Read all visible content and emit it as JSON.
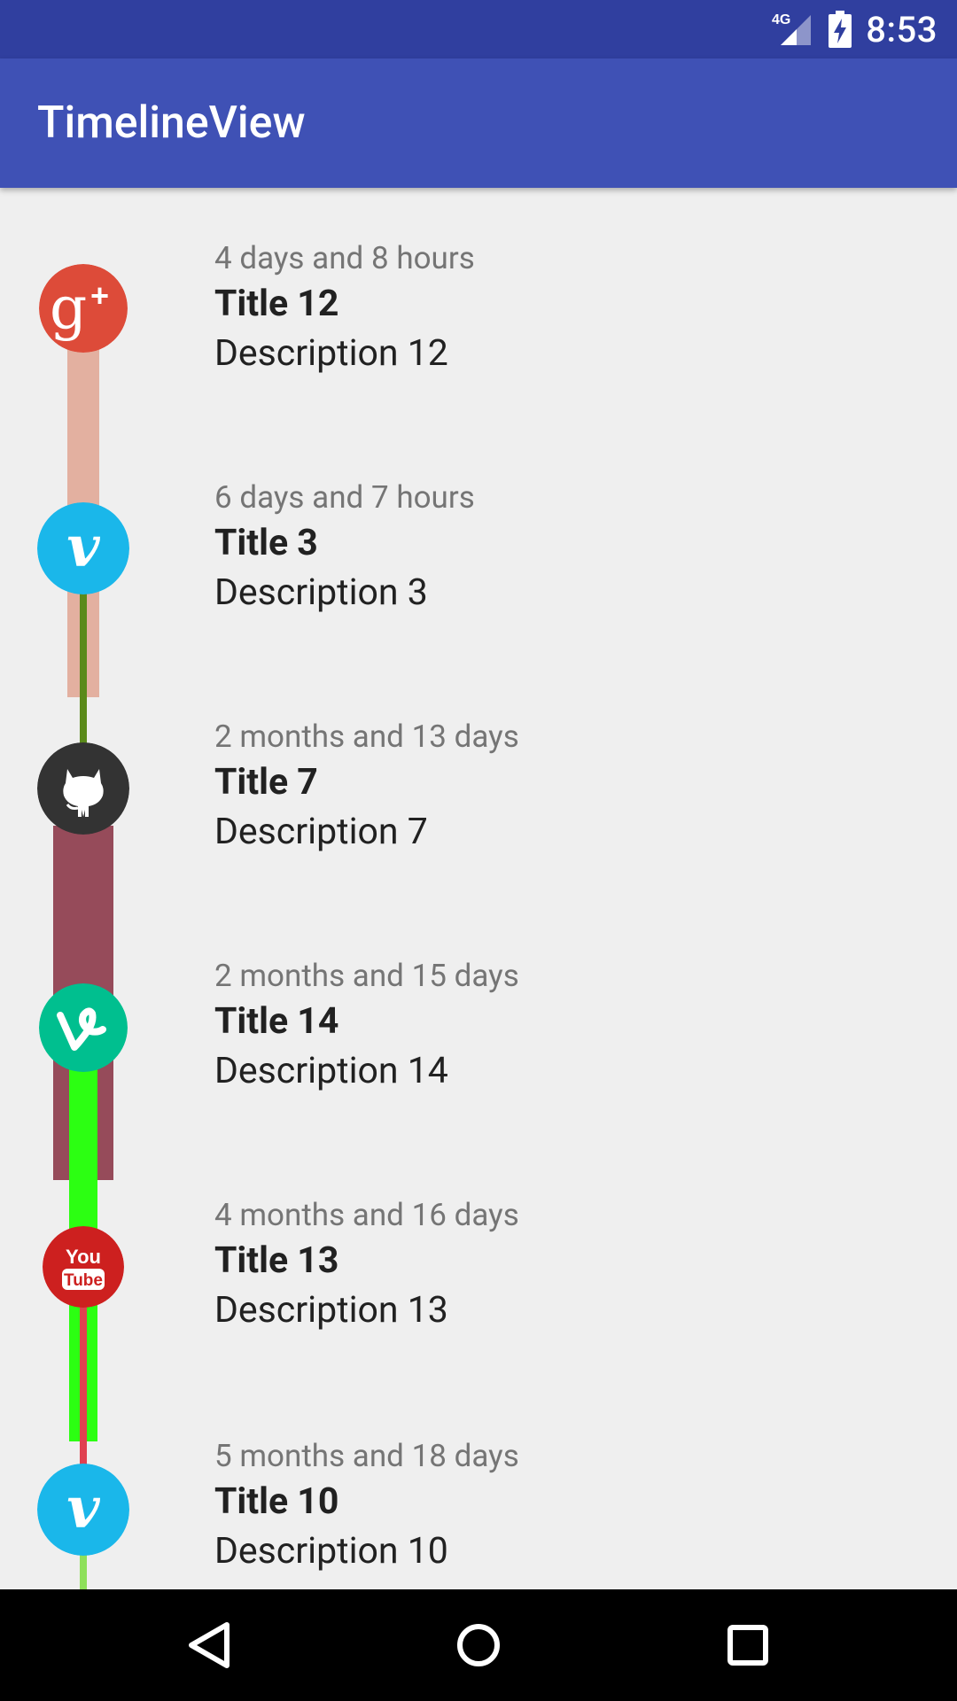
{
  "status_bar": {
    "network": "4G",
    "time": "8:53"
  },
  "app_bar": {
    "title": "TimelineView"
  },
  "timeline": {
    "items": [
      {
        "time": "4 days and 8 hours",
        "title": "Title 12",
        "description": "Description 12",
        "icon": "google-plus-icon",
        "color": "#dd4b39"
      },
      {
        "time": "6 days and 7 hours",
        "title": "Title 3",
        "description": "Description 3",
        "icon": "vimeo-icon",
        "color": "#1ab7ea"
      },
      {
        "time": "2 months and 13 days",
        "title": "Title 7",
        "description": "Description 7",
        "icon": "github-icon",
        "color": "#333333"
      },
      {
        "time": "2 months and 15 days",
        "title": "Title 14",
        "description": "Description 14",
        "icon": "vine-icon",
        "color": "#00bf8f"
      },
      {
        "time": "4 months and 16 days",
        "title": "Title 13",
        "description": "Description 13",
        "icon": "youtube-icon",
        "color": "#cd201f"
      },
      {
        "time": "5 months and 18 days",
        "title": "Title 10",
        "description": "Description 10",
        "icon": "vimeo-icon",
        "color": "#1ab7ea"
      }
    ],
    "connector_colors": [
      "#e3b0a0",
      "#5a8a1a",
      "#964b5a",
      "#2cff12",
      "#e04050",
      "#8ee05a"
    ]
  },
  "nav_bar": {
    "back": "back-icon",
    "home": "home-icon",
    "recents": "recents-icon"
  }
}
